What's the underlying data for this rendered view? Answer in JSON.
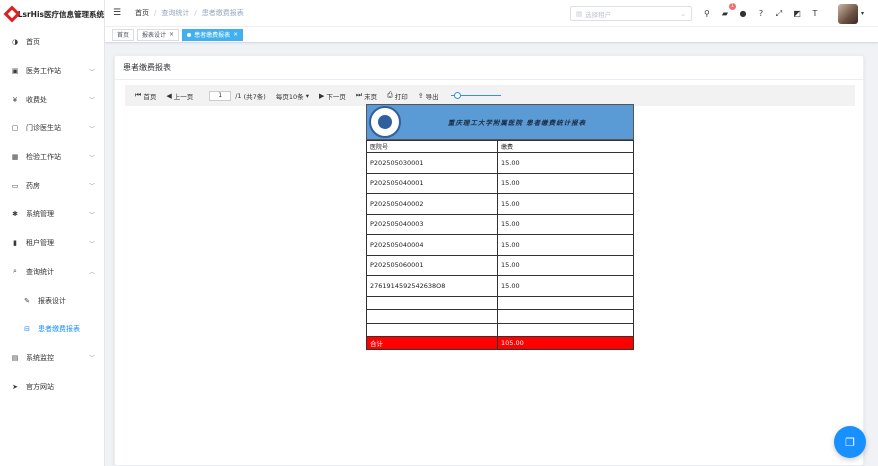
{
  "app": {
    "title": "LsrHis医疗信息管理系统"
  },
  "sidebar": {
    "items": [
      {
        "label": "首页",
        "icon": "dashboard-icon",
        "glyph": "◑",
        "expandable": false
      },
      {
        "label": "医务工作站",
        "icon": "doctor-icon",
        "glyph": "▣",
        "expandable": true
      },
      {
        "label": "收费处",
        "icon": "yen-icon",
        "glyph": "¥",
        "expandable": true
      },
      {
        "label": "门诊医生站",
        "icon": "clinic-icon",
        "glyph": "▢",
        "expandable": true
      },
      {
        "label": "检验工作站",
        "icon": "lab-icon",
        "glyph": "▦",
        "expandable": true
      },
      {
        "label": "药房",
        "icon": "pharmacy-icon",
        "glyph": "▭",
        "expandable": true
      },
      {
        "label": "系统管理",
        "icon": "gear-icon",
        "glyph": "✱",
        "expandable": true
      },
      {
        "label": "租户管理",
        "icon": "bar-chart-icon",
        "glyph": "▮",
        "expandable": true
      },
      {
        "label": "查询统计",
        "icon": "search-icon",
        "glyph": "⌕",
        "expandable": true,
        "expanded": true
      },
      {
        "label": "报表设计",
        "icon": "edit-icon",
        "glyph": "✎",
        "sub": true
      },
      {
        "label": "患者缴费报表",
        "icon": "report-icon",
        "glyph": "⊟",
        "sub": true,
        "active": true
      },
      {
        "label": "系统监控",
        "icon": "monitor-icon",
        "glyph": "▤",
        "expandable": true
      },
      {
        "label": "官方网站",
        "icon": "send-icon",
        "glyph": "➤",
        "expandable": false
      }
    ]
  },
  "header": {
    "breadcrumb": [
      "首页",
      "查询统计",
      "患者缴费报表"
    ],
    "tenant_placeholder": "选择租户",
    "notification_count": "1"
  },
  "tags": [
    {
      "label": "首页"
    },
    {
      "label": "报表设计",
      "closable": true
    },
    {
      "label": "患者缴费报表",
      "closable": true,
      "active": true
    }
  ],
  "content": {
    "title": "患者缴费报表",
    "toolbar": {
      "first": "首页",
      "prev": "上一页",
      "page_value": "1",
      "page_total": "/1",
      "record_count": "(共7条)",
      "page_size": "每页10条",
      "next": "下一页",
      "last": "末页",
      "print": "打印",
      "export": "导出"
    }
  },
  "report": {
    "title": "重庆理工大学附属医院 患者缴费统计报表",
    "columns": [
      "医院号",
      "缴费"
    ],
    "rows": [
      [
        "P202505030001",
        "15.00"
      ],
      [
        "P202505040001",
        "15.00"
      ],
      [
        "P202505040002",
        "15.00"
      ],
      [
        "P202505040003",
        "15.00"
      ],
      [
        "P202505040004",
        "15.00"
      ],
      [
        "P202505060001",
        "15.00"
      ],
      [
        "2761914592542638O8",
        "15.00"
      ]
    ],
    "total_label": "合计",
    "total_value": "105.00",
    "colors": {
      "header_bg": "#5b9bd5",
      "total_bg": "#ff0000"
    }
  },
  "colors": {
    "accent": "#1890ff",
    "active_tag": "#42b0ef"
  }
}
